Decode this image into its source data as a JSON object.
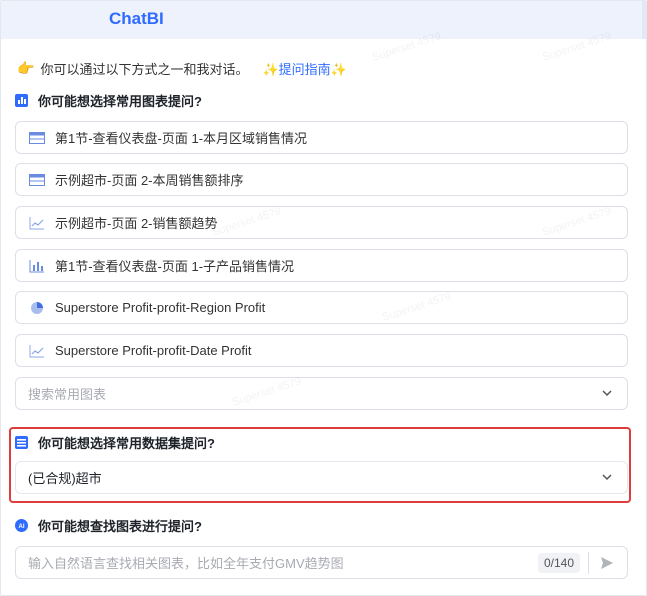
{
  "app": {
    "title": "ChatBI"
  },
  "intro": {
    "text": "你可以通过以下方式之一和我对话。",
    "guide_label": "提问指南"
  },
  "sections": {
    "charts_title": "你可能想选择常用图表提问?",
    "dataset_title": "你可能想选择常用数据集提问?",
    "find_title": "你可能想查找图表进行提问?"
  },
  "chart_items": [
    {
      "label": "第1节-查看仪表盘-页面 1-本月区域销售情况",
      "icon": "table-icon"
    },
    {
      "label": "示例超市-页面 2-本周销售额排序",
      "icon": "table-icon"
    },
    {
      "label": "示例超市-页面 2-销售额趋势",
      "icon": "line-chart-icon"
    },
    {
      "label": "第1节-查看仪表盘-页面 1-子产品销售情况",
      "icon": "bar-chart-icon"
    },
    {
      "label": "Superstore Profit-profit-Region Profit",
      "icon": "pie-chart-icon"
    },
    {
      "label": "Superstore Profit-profit-Date Profit",
      "icon": "line-chart-icon"
    }
  ],
  "chart_search": {
    "placeholder": "搜索常用图表"
  },
  "dataset_select": {
    "value": "(已合规)超市"
  },
  "query": {
    "placeholder": "输入自然语言查找相关图表，比如全年支付GMV趋势图",
    "counter": "0/140"
  },
  "colors": {
    "accent": "#2f6bff",
    "highlight_border": "#e03c3c"
  }
}
